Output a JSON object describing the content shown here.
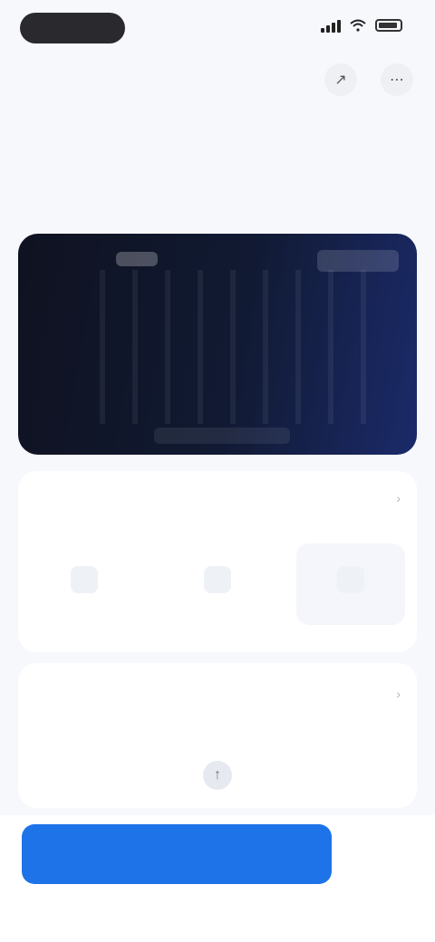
{
  "status_bar": {
    "time": "",
    "pill_color": "#2a2a2e"
  },
  "header": {
    "section_label": "",
    "link_text": ""
  },
  "page": {
    "title": "",
    "meta_left": "",
    "meta_mid": "",
    "meta_right": ""
  },
  "media": {
    "tag": "",
    "brand": "",
    "caption": ""
  },
  "options_card": {
    "title": "",
    "items": [
      {
        "label": ""
      },
      {
        "label": ""
      },
      {
        "label": ""
      }
    ]
  },
  "settings_card": {
    "title": ""
  },
  "actions": {
    "primary_label": "",
    "secondary_label": ""
  },
  "colors": {
    "accent": "#1e73e8",
    "background": "#f6f8fc",
    "card": "#ffffff"
  }
}
